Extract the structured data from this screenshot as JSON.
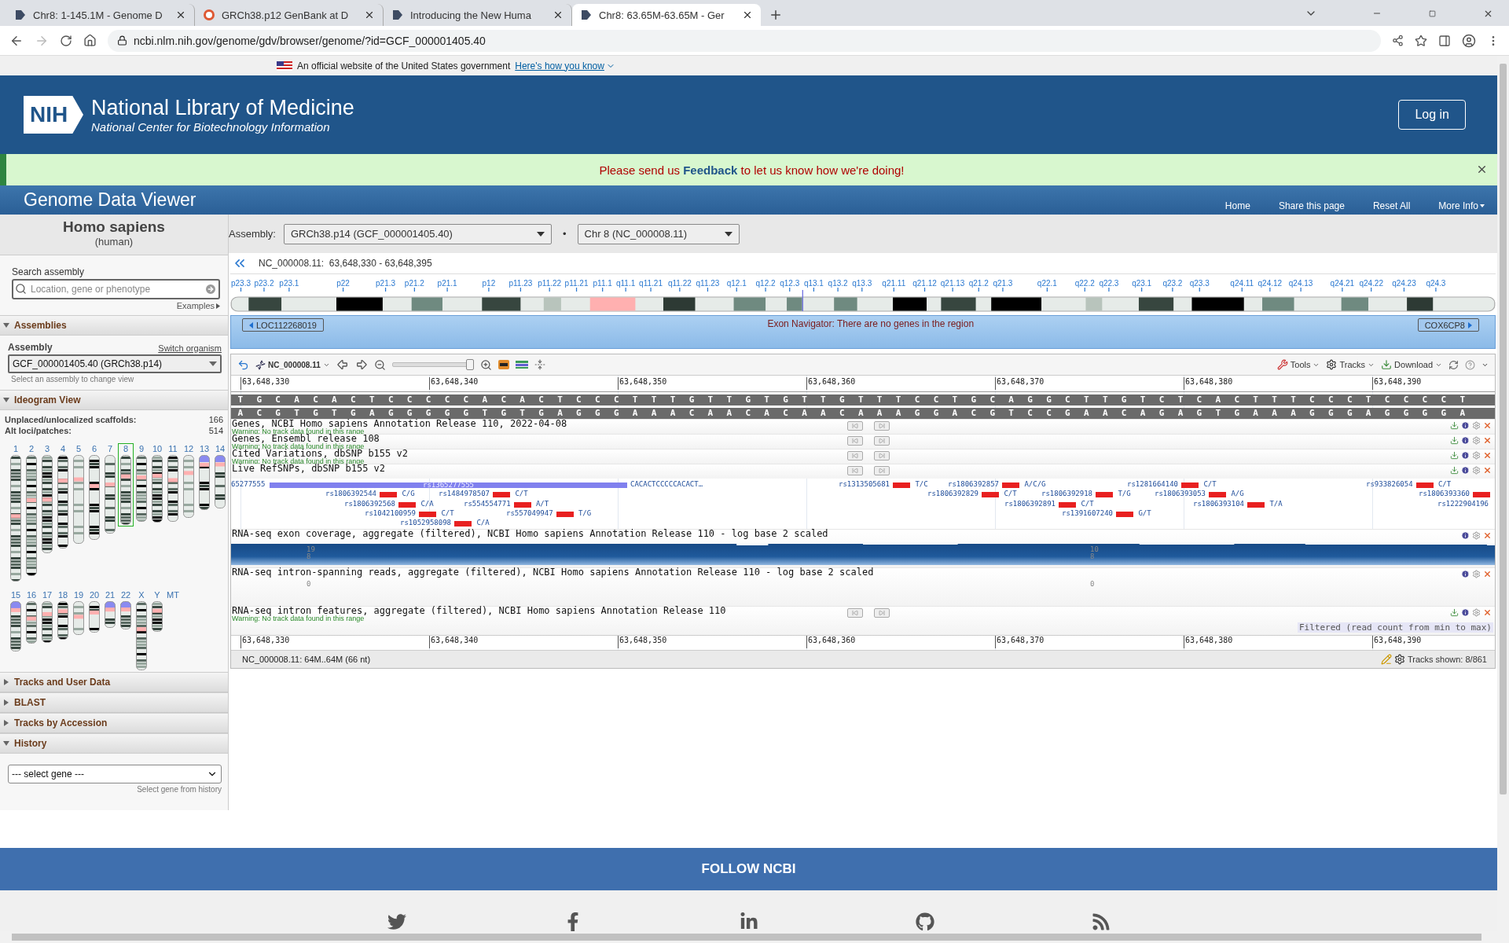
{
  "browser": {
    "tabs": [
      {
        "title": "Chr8: 1-145.1M - Genome D",
        "kind": "ncbi",
        "selected": false
      },
      {
        "title": "GRCh38.p12 GenBank at D",
        "kind": "search",
        "selected": false
      },
      {
        "title": "Introducing the New Huma",
        "kind": "ncbi",
        "selected": false
      },
      {
        "title": "Chr8: 63.65M-63.65M - Ger",
        "kind": "ncbi",
        "selected": true
      }
    ],
    "url": "ncbi.nlm.nih.gov/genome/gdv/browser/genome/?id=GCF_000001405.40"
  },
  "gov_banner": {
    "text": "An official website of the United States government",
    "link": "Here's how you know"
  },
  "header": {
    "logo": "NIH",
    "title": "National Library of Medicine",
    "subtitle": "National Center for Biotechnology Information",
    "login": "Log in"
  },
  "feedback": {
    "before": "Please send us",
    "link": "Feedback",
    "after": "to let us know how we're doing!"
  },
  "app_bar": {
    "title": "Genome Data Viewer",
    "nav": [
      "Home",
      "Share this page",
      "Reset All",
      "More Info"
    ]
  },
  "sidebar": {
    "organism": "Homo sapiens",
    "common_name": "(human)",
    "search": {
      "label": "Search assembly",
      "placeholder": "Location, gene or phenotype",
      "examples": "Examples"
    },
    "sections": [
      {
        "kind": "assemblies",
        "title": "Assemblies",
        "expanded": true,
        "label": "Assembly",
        "link": "Switch organism",
        "value": "GCF_000001405.40 (GRCh38.p14)",
        "hint": "Select an assembly to change view"
      },
      {
        "kind": "ideogram",
        "title": "Ideogram View",
        "expanded": true,
        "stats": [
          {
            "label": "Unplaced/unlocalized scaffolds:",
            "value": "166"
          },
          {
            "label": "Alt loci/patches:",
            "value": "514"
          }
        ],
        "chromosomes": [
          {
            "label": "1",
            "selected": false
          },
          {
            "label": "2",
            "selected": false
          },
          {
            "label": "3",
            "selected": false
          },
          {
            "label": "4",
            "selected": false
          },
          {
            "label": "5",
            "selected": false
          },
          {
            "label": "6",
            "selected": false
          },
          {
            "label": "7",
            "selected": false
          },
          {
            "label": "8",
            "selected": true
          },
          {
            "label": "9",
            "selected": false
          },
          {
            "label": "10",
            "selected": false
          },
          {
            "label": "11",
            "selected": false
          },
          {
            "label": "12",
            "selected": false
          },
          {
            "label": "13",
            "selected": false
          },
          {
            "label": "14",
            "selected": false
          },
          {
            "label": "15",
            "selected": false
          },
          {
            "label": "16",
            "selected": false
          },
          {
            "label": "17",
            "selected": false
          },
          {
            "label": "18",
            "selected": false
          },
          {
            "label": "19",
            "selected": false
          },
          {
            "label": "20",
            "selected": false
          },
          {
            "label": "21",
            "selected": false
          },
          {
            "label": "22",
            "selected": false
          },
          {
            "label": "X",
            "selected": false
          },
          {
            "label": "Y",
            "selected": false
          },
          {
            "label": "MT",
            "selected": false
          }
        ]
      },
      {
        "kind": "plain",
        "title": "Tracks and User Data",
        "expanded": false
      },
      {
        "kind": "plain",
        "title": "BLAST",
        "expanded": false
      },
      {
        "kind": "plain",
        "title": "Tracks by Accession",
        "expanded": false
      },
      {
        "kind": "history",
        "title": "History",
        "expanded": true,
        "value": "--- select gene ---",
        "hint": "Select gene from history"
      }
    ]
  },
  "assembly_bar": {
    "label": "Assembly:",
    "assembly": "GRCh38.p14 (GCF_000001405.40)",
    "separator": "•",
    "chromosome": "Chr 8 (NC_000008.11)"
  },
  "location": "NC_000008.11:  63,648,330 - 63,648,395",
  "bands": [
    "p23.3",
    "p23.2",
    "p23.1",
    "p22",
    "p21.3",
    "p21.2",
    "p21.1",
    "p12",
    "p11.23",
    "p11.22",
    "p11.21",
    "p11.1",
    "q11.1",
    "q11.21",
    "q11.22",
    "q11.23",
    "q12.1",
    "q12.2",
    "q12.3",
    "q13.1",
    "q13.2",
    "q13.3",
    "q21.11",
    "q21.12",
    "q21.13",
    "q21.2",
    "q21.3",
    "q22.1",
    "q22.2",
    "q22.3",
    "q23.1",
    "q23.2",
    "q23.3",
    "q24.11",
    "q24.12",
    "q24.13",
    "q24.21",
    "q24.22",
    "q24.23",
    "q24.3"
  ],
  "exon_navigator": {
    "prev": "LOC112268019",
    "message": "Exon Navigator: There are no genes in the region",
    "next": "COX6CP8"
  },
  "viewer": {
    "toolbar": {
      "sequence": "NC_000008.11",
      "zoom": {
        "level": 1
      },
      "tools": "Tools",
      "tracks": "Tracks",
      "download": "Download"
    },
    "ruler": [
      "63,648,330",
      "63,648,340",
      "63,648,350",
      "63,648,360",
      "63,648,370",
      "63,648,380",
      "63,648,390"
    ],
    "strand_plus": "TGCACACTCCCCCACACTCCCTTTGTTGTGTTGTTTCCTGCAGGCTTGTCTCACTTTCCCTCCCCT",
    "strand_minus": "ACGTGTGAGGGGGTGTGAGGGAAACAACACAACAAAGGACGTCCGAACAGAGTGAAAGGGAGGGGA",
    "tracks": [
      {
        "kind": "features",
        "title": "Genes, NCBI Homo sapiens Annotation Release 110, 2022-04-08",
        "warning": "Warning: No track data found in this range",
        "downloadable": true
      },
      {
        "kind": "features",
        "title": "Genes, Ensembl release 108",
        "warning": "Warning: No track data found in this range",
        "downloadable": true
      },
      {
        "kind": "features",
        "title": "Cited Variations, dbSNP b155 v2",
        "warning": "Warning: No track data found in this range",
        "downloadable": true
      },
      {
        "kind": "snps",
        "title": "Live RefSNPs, dbSNP b155 v2",
        "downloadable": true,
        "rows": [
          [
            {
              "kind": "text",
              "id": "65277555"
            },
            {
              "kind": "insertion",
              "id": "rs1365277555",
              "sequence": "CACACTCCCCCACACT…"
            },
            {
              "kind": "snp",
              "id": "rs1313505681",
              "allele": "T/C"
            },
            {
              "kind": "snp",
              "id": "rs1806392857",
              "allele": "A/C/G"
            },
            {
              "kind": "snp",
              "id": "rs1281664140",
              "allele": "C/T"
            },
            {
              "kind": "snp",
              "id": "rs933826054",
              "allele": "C/T"
            }
          ],
          [
            {
              "kind": "snp",
              "id": "rs1806392544",
              "allele": "C/G"
            },
            {
              "kind": "snp",
              "id": "rs1484978507",
              "allele": "C/T"
            },
            {
              "kind": "snp",
              "id": "rs1806392829",
              "allele": "C/T"
            },
            {
              "kind": "snp",
              "id": "rs1806392918",
              "allele": "T/G"
            },
            {
              "kind": "snp",
              "id": "rs1806393053",
              "allele": "A/G"
            },
            {
              "kind": "snp",
              "id": "rs1806393360"
            }
          ],
          [
            {
              "kind": "snp",
              "id": "rs1806392568",
              "allele": "C/A"
            },
            {
              "kind": "snp",
              "id": "rs554554771",
              "allele": "A/T"
            },
            {
              "kind": "snp",
              "id": "rs1806392891",
              "allele": "C/T"
            },
            {
              "kind": "snp",
              "id": "rs1806393104",
              "allele": "T/A"
            },
            {
              "kind": "text",
              "id": "rs1222904196"
            }
          ],
          [
            {
              "kind": "snp",
              "id": "rs1042100959",
              "allele": "C/T"
            },
            {
              "kind": "snp",
              "id": "rs557049947",
              "allele": "T/G"
            },
            {
              "kind": "snp",
              "id": "rs1391607240",
              "allele": "G/T"
            }
          ],
          [
            {
              "kind": "snp",
              "id": "rs1052958098",
              "allele": "C/A"
            }
          ]
        ]
      },
      {
        "kind": "coverage",
        "title": "RNA-seq exon coverage, aggregate (filtered), NCBI Homo sapiens Annotation Release 110 - log base 2 scaled",
        "downloadable": false,
        "scale": [
          {
            "max": "19",
            "min": "8"
          },
          {
            "max": "10",
            "min": "8"
          }
        ]
      },
      {
        "kind": "reads",
        "title": "RNA-seq intron-spanning reads, aggregate (filtered), NCBI Homo sapiens Annotation Release 110 - log base 2 scaled",
        "downloadable": false,
        "marks": [
          "0",
          "0"
        ]
      },
      {
        "kind": "features",
        "title": "RNA-seq intron features, aggregate (filtered), NCBI Homo sapiens Annotation Release 110",
        "warning": "Warning: No track data found in this range",
        "downloadable": true,
        "note": "Filtered (read count from min to max)"
      }
    ],
    "bottom_ruler": [
      "63,648,330",
      "63,648,340",
      "63,648,350",
      "63,648,360",
      "63,648,370",
      "63,648,380",
      "63,648,390"
    ],
    "status": "NC_000008.11: 64M..64M (66 nt)",
    "tracks_shown": "Tracks shown: 8/861"
  },
  "footer": {
    "title": "FOLLOW NCBI"
  }
}
